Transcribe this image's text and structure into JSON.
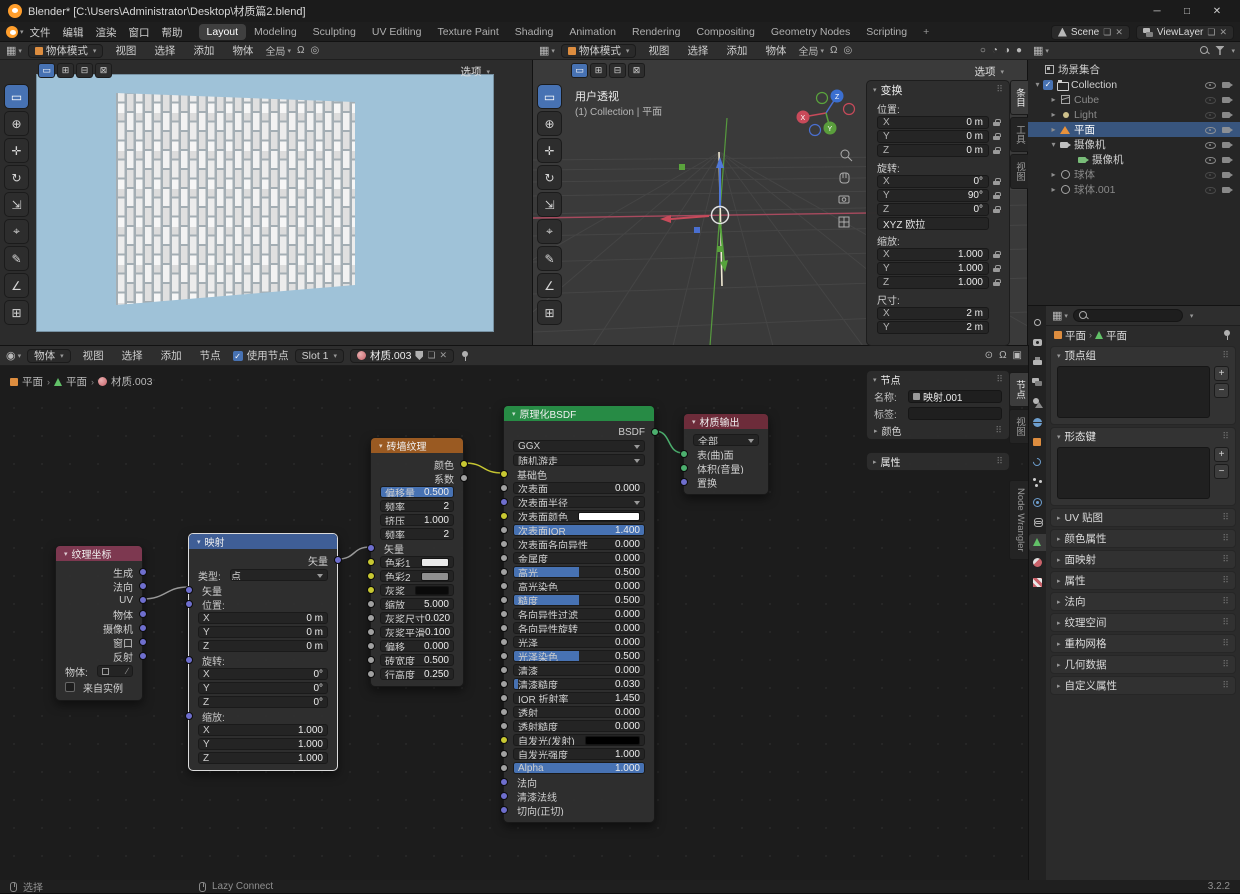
{
  "titlebar": {
    "title": "Blender* [C:\\Users\\Administrator\\Desktop\\材质篇2.blend]",
    "minimize": "─",
    "maximize": "□",
    "close": "✕"
  },
  "topbar": {
    "menus": [
      "文件",
      "编辑",
      "渲染",
      "窗口",
      "帮助"
    ],
    "workspaces": [
      {
        "label": "Layout",
        "cls": "active"
      },
      {
        "label": "Modeling",
        "cls": ""
      },
      {
        "label": "Sculpting",
        "cls": ""
      },
      {
        "label": "UV Editing",
        "cls": ""
      },
      {
        "label": "Texture Paint",
        "cls": ""
      },
      {
        "label": "Shading",
        "cls": ""
      },
      {
        "label": "Animation",
        "cls": ""
      },
      {
        "label": "Rendering",
        "cls": ""
      },
      {
        "label": "Compositing",
        "cls": ""
      },
      {
        "label": "Geometry Nodes",
        "cls": ""
      },
      {
        "label": "Scripting",
        "cls": ""
      }
    ],
    "add_tab": "+",
    "scene": "Scene",
    "viewlayer": "ViewLayer"
  },
  "icons": {
    "editor_grid": "▦",
    "node_editor": "◉",
    "snap": "Ω",
    "proportional": "◎",
    "overlay": "⊙",
    "extra": "▣",
    "shading": [
      "○",
      "◔",
      "◑",
      "●"
    ],
    "select_modes": [
      "▭",
      "⊞",
      "⊟",
      "⊠"
    ]
  },
  "tools": [
    {
      "name": "select-box-tool",
      "glyph": "▭",
      "cls": "active"
    },
    {
      "name": "cursor-tool",
      "glyph": "⊕",
      "cls": ""
    },
    {
      "name": "move-tool",
      "glyph": "✛",
      "cls": ""
    },
    {
      "name": "rotate-tool",
      "glyph": "↻",
      "cls": ""
    },
    {
      "name": "scale-tool",
      "glyph": "⇲",
      "cls": ""
    },
    {
      "name": "transform-tool",
      "glyph": "⌖",
      "cls": ""
    },
    {
      "name": "annotate-tool",
      "glyph": "✎",
      "cls": ""
    },
    {
      "name": "measure-tool",
      "glyph": "∠",
      "cls": ""
    },
    {
      "name": "add-cube-tool",
      "glyph": "⊞",
      "cls": ""
    }
  ],
  "vp": {
    "mode": "物体模式",
    "menus": [
      "视图",
      "选择",
      "添加",
      "物体"
    ],
    "orientation": "全局",
    "options": "选项"
  },
  "vp_right": {
    "persp_label": "用户透视",
    "collection_label": "(1) Collection | 平面",
    "axis_x": "X",
    "axis_y": "Y",
    "axis_z": "Z"
  },
  "sidebar_tabs": [
    {
      "label": "条目",
      "cls": "active"
    },
    {
      "label": "工具",
      "cls": ""
    },
    {
      "label": "视图",
      "cls": ""
    }
  ],
  "transform": {
    "title": "变换",
    "rows": [
      {
        "label": "位置:",
        "value": "",
        "cls": "group"
      },
      {
        "label": "X",
        "value": "0 m",
        "cls": "field"
      },
      {
        "label": "Y",
        "value": "0 m",
        "cls": "field"
      },
      {
        "label": "Z",
        "value": "0 m",
        "cls": "field"
      },
      {
        "label": "旋转:",
        "value": "",
        "cls": "group"
      },
      {
        "label": "X",
        "value": "0°",
        "cls": "field"
      },
      {
        "label": "Y",
        "value": "90°",
        "cls": "field"
      },
      {
        "label": "Z",
        "value": "0°",
        "cls": "field"
      },
      {
        "label": "XYZ 欧拉",
        "value": "",
        "cls": "drop"
      },
      {
        "label": "缩放:",
        "value": "",
        "cls": "group"
      },
      {
        "label": "X",
        "value": "1.000",
        "cls": "field"
      },
      {
        "label": "Y",
        "value": "1.000",
        "cls": "field"
      },
      {
        "label": "Z",
        "value": "1.000",
        "cls": "field"
      },
      {
        "label": "尺寸:",
        "value": "",
        "cls": "group"
      },
      {
        "label": "X",
        "value": "2 m",
        "cls": "field nolock"
      },
      {
        "label": "Y",
        "value": "2 m",
        "cls": "field nolock"
      }
    ]
  },
  "outliner": {
    "rows": [
      {
        "expander": "",
        "label": "场景集合",
        "icon": "scene",
        "cls": "scene"
      },
      {
        "expander": "▾",
        "label": "Collection",
        "icon": "coll",
        "cls": "collection"
      },
      {
        "expander": "▸",
        "label": "Cube",
        "icon": "cube",
        "cls": "child dim"
      },
      {
        "expander": "▸",
        "label": "Light",
        "icon": "light",
        "cls": "child dim"
      },
      {
        "expander": "▸",
        "label": "平面",
        "icon": "plane",
        "cls": "child sel"
      },
      {
        "expander": "▾",
        "label": "摄像机",
        "icon": "cam",
        "cls": "child"
      },
      {
        "expander": "",
        "label": "摄像机",
        "icon": "camdata",
        "cls": "grandchild"
      },
      {
        "expander": "▸",
        "label": "球体",
        "icon": "sphere",
        "cls": "child dim"
      },
      {
        "expander": "▸",
        "label": "球体.001",
        "icon": "sphere",
        "cls": "child dim"
      }
    ]
  },
  "props": {
    "tabs": [
      {
        "icon": "tool",
        "cls": ""
      },
      {
        "icon": "render",
        "cls": ""
      },
      {
        "icon": "output",
        "cls": ""
      },
      {
        "icon": "viewlayer",
        "cls": ""
      },
      {
        "icon": "scene",
        "cls": ""
      },
      {
        "icon": "world",
        "cls": ""
      },
      {
        "icon": "object",
        "cls": ""
      },
      {
        "icon": "modifiers",
        "cls": ""
      },
      {
        "icon": "particles",
        "cls": ""
      },
      {
        "icon": "physics",
        "cls": ""
      },
      {
        "icon": "constraints",
        "cls": ""
      },
      {
        "icon": "data",
        "cls": "active"
      },
      {
        "icon": "material",
        "cls": ""
      },
      {
        "icon": "texture",
        "cls": ""
      }
    ],
    "breadcrumb": [
      "平面",
      "平面"
    ],
    "open_panels": [
      "顶点组",
      "形态键"
    ],
    "closed_panels": [
      "UV 贴图",
      "颜色属性",
      "面映射",
      "属性",
      "法向",
      "纹理空间",
      "重构网格",
      "几何数据",
      "自定义属性"
    ],
    "add_label": "+",
    "remove_label": "−"
  },
  "node_editor": {
    "mode": "物体",
    "menus": [
      "视图",
      "选择",
      "添加",
      "节点"
    ],
    "use_nodes": "使用节点",
    "slot": "Slot 1",
    "material": "材质.003",
    "breadcrumb": [
      "平面",
      "平面",
      "材质.003"
    ],
    "sidebar_tabs": [
      {
        "label": "节点",
        "cls": "active"
      },
      {
        "label": "视图",
        "cls": ""
      }
    ],
    "wrangler": "Node Wrangler",
    "npanel": {
      "title": "节点",
      "name_label": "名称:",
      "name_value": "映射.001",
      "label_label": "标签:",
      "color_label": "颜色",
      "attributes_title": "属性"
    }
  },
  "nodes": {
    "texcoord": {
      "title": "纹理坐标",
      "outputs": [
        "生成",
        "法向",
        "UV",
        "物体",
        "摄像机",
        "窗口",
        "反射"
      ],
      "object_label": "物体:",
      "instance_label": "来自实例"
    },
    "mapping": {
      "title": "映射",
      "output": "矢量",
      "type_label": "类型:",
      "type_value": "点",
      "rows": [
        {
          "label": "矢量",
          "cls": "plain",
          "dot": "purple"
        },
        {
          "label": "位置:",
          "cls": "group",
          "dot": "purple"
        },
        {
          "label": "X",
          "value": "0 m",
          "cls": "xyz"
        },
        {
          "label": "Y",
          "value": "0 m",
          "cls": "xyz"
        },
        {
          "label": "Z",
          "value": "0 m",
          "cls": "xyz"
        },
        {
          "label": "旋转:",
          "cls": "group",
          "dot": "purple"
        },
        {
          "label": "X",
          "value": "0°",
          "cls": "xyz"
        },
        {
          "label": "Y",
          "value": "0°",
          "cls": "xyz"
        },
        {
          "label": "Z",
          "value": "0°",
          "cls": "xyz"
        },
        {
          "label": "缩放:",
          "cls": "group",
          "dot": "purple"
        },
        {
          "label": "X",
          "value": "1.000",
          "cls": "xyz"
        },
        {
          "label": "Y",
          "value": "1.000",
          "cls": "xyz"
        },
        {
          "label": "Z",
          "value": "1.000",
          "cls": "xyz"
        }
      ]
    },
    "brick": {
      "title": "砖墙纹理",
      "outputs": [
        {
          "label": "颜色",
          "dot": "yellow"
        },
        {
          "label": "系数",
          "dot": "grey"
        }
      ],
      "rows": [
        {
          "label": "偏移量",
          "value": "0.500",
          "cls": "slider",
          "fill": 100
        },
        {
          "label": "频率",
          "value": "2",
          "cls": "value"
        },
        {
          "label": "挤压",
          "value": "1.000",
          "cls": "value"
        },
        {
          "label": "频率",
          "value": "2",
          "cls": "value"
        },
        {
          "label": "矢量",
          "cls": "plain",
          "dot": "purple"
        },
        {
          "label": "色彩1",
          "cls": "color",
          "swatch": "#e9e9e9",
          "dot": "yellow"
        },
        {
          "label": "色彩2",
          "cls": "color",
          "swatch": "#8f8f8f",
          "dot": "yellow"
        },
        {
          "label": "灰浆",
          "cls": "color",
          "swatch": "#0a0a0a",
          "dot": "yellow"
        },
        {
          "label": "缩放",
          "value": "5.000",
          "cls": "value",
          "dot": "grey"
        },
        {
          "label": "灰浆尺寸",
          "value": "0.020",
          "cls": "value",
          "dot": "grey"
        },
        {
          "label": "灰浆平滑",
          "value": "0.100",
          "cls": "value",
          "dot": "grey"
        },
        {
          "label": "偏移",
          "value": "0.000",
          "cls": "value",
          "dot": "grey"
        },
        {
          "label": "砖宽度",
          "value": "0.500",
          "cls": "value",
          "dot": "grey"
        },
        {
          "label": "行高度",
          "value": "0.250",
          "cls": "value",
          "dot": "grey"
        }
      ]
    },
    "bsdf": {
      "title": "原理化BSDF",
      "output": "BSDF",
      "distribution": "GGX",
      "method": "随机游走",
      "rows": [
        {
          "label": "基础色",
          "cls": "plain",
          "dot": "yellow"
        },
        {
          "label": "次表面",
          "value": "0.000",
          "cls": "slider",
          "dot": "grey",
          "fill": 0
        },
        {
          "label": "次表面半径",
          "cls": "dropfield",
          "dot": "purple"
        },
        {
          "label": "次表面颜色",
          "cls": "color",
          "swatch": "#ffffff",
          "dot": "yellow"
        },
        {
          "label": "次表面IOR",
          "value": "1.400",
          "cls": "slider",
          "dot": "grey",
          "fill": 100
        },
        {
          "label": "次表面各向异性",
          "value": "0.000",
          "cls": "slider",
          "dot": "grey",
          "fill": 0
        },
        {
          "label": "金属度",
          "value": "0.000",
          "cls": "slider",
          "dot": "grey",
          "fill": 0
        },
        {
          "label": "高光",
          "value": "0.500",
          "cls": "slider",
          "dot": "grey",
          "fill": 50
        },
        {
          "label": "高光染色",
          "value": "0.000",
          "cls": "slider",
          "dot": "grey",
          "fill": 0
        },
        {
          "label": "糙度",
          "value": "0.500",
          "cls": "slider",
          "dot": "grey",
          "fill": 50
        },
        {
          "label": "各向异性过滤",
          "value": "0.000",
          "cls": "slider",
          "dot": "grey",
          "fill": 0
        },
        {
          "label": "各向异性旋转",
          "value": "0.000",
          "cls": "slider",
          "dot": "grey",
          "fill": 0
        },
        {
          "label": "光泽",
          "value": "0.000",
          "cls": "slider",
          "dot": "grey",
          "fill": 0
        },
        {
          "label": "光泽染色",
          "value": "0.500",
          "cls": "slider",
          "dot": "grey",
          "fill": 50
        },
        {
          "label": "清漆",
          "value": "0.000",
          "cls": "slider",
          "dot": "grey",
          "fill": 0
        },
        {
          "label": "清漆糙度",
          "value": "0.030",
          "cls": "slider",
          "dot": "grey",
          "fill": 3
        },
        {
          "label": "IOR 折射率",
          "value": "1.450",
          "cls": "value",
          "dot": "grey"
        },
        {
          "label": "透射",
          "value": "0.000",
          "cls": "slider",
          "dot": "grey",
          "fill": 0
        },
        {
          "label": "透射糙度",
          "value": "0.000",
          "cls": "slider",
          "dot": "grey",
          "fill": 0
        },
        {
          "label": "自发光(发射)",
          "cls": "color",
          "swatch": "#000000",
          "dot": "yellow"
        },
        {
          "label": "自发光强度",
          "value": "1.000",
          "cls": "value",
          "dot": "grey"
        },
        {
          "label": "Alpha",
          "value": "1.000",
          "cls": "slider",
          "dot": "grey",
          "fill": 100
        },
        {
          "label": "法向",
          "cls": "plain",
          "dot": "purple"
        },
        {
          "label": "清漆法线",
          "cls": "plain",
          "dot": "purple"
        },
        {
          "label": "切向(正切)",
          "cls": "plain",
          "dot": "purple"
        }
      ]
    },
    "output": {
      "title": "材质输出",
      "target": "全部",
      "rows": [
        {
          "label": "表(曲)面",
          "cls": "plain",
          "dot": "green"
        },
        {
          "label": "体积(音量)",
          "cls": "plain",
          "dot": "green"
        },
        {
          "label": "置换",
          "cls": "plain",
          "dot": "purple"
        }
      ]
    }
  },
  "statusbar": {
    "left": "选择",
    "middle": "Lazy Connect",
    "version": "3.2.2"
  }
}
